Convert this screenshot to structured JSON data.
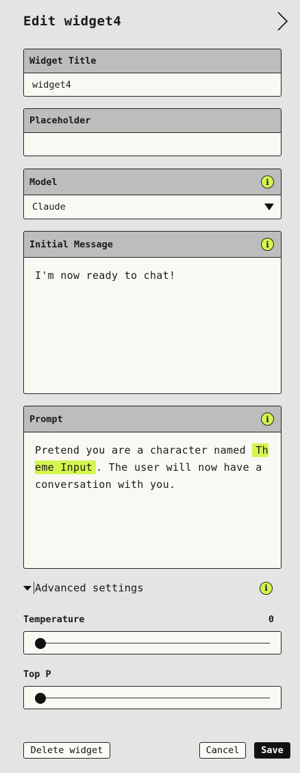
{
  "header": {
    "title": "Edit widget4"
  },
  "fields": {
    "widget_title": {
      "label": "Widget Title",
      "value": "widget4"
    },
    "placeholder": {
      "label": "Placeholder",
      "value": ""
    },
    "model": {
      "label": "Model",
      "value": "Claude",
      "info": "i"
    },
    "initial_message": {
      "label": "Initial Message",
      "value": "I'm now ready to chat!",
      "info": "i"
    },
    "prompt": {
      "label": "Prompt",
      "text_before": "Pretend you are a character named ",
      "variable": "Theme Input",
      "text_after": ". The user will now have a conversation with you.",
      "info": "i"
    }
  },
  "advanced": {
    "label": "Advanced settings",
    "info": "i"
  },
  "temperature": {
    "label": "Temperature",
    "value": "0",
    "level": 0
  },
  "top_p": {
    "label": "Top P",
    "level": 0
  },
  "buttons": {
    "delete": "Delete widget",
    "cancel": "Cancel",
    "save": "Save"
  },
  "colors": {
    "accent": "#d4f54e",
    "header_bg": "#bdbdbd",
    "page_bg": "#e4e4e4",
    "field_bg": "#f9f8f2"
  }
}
